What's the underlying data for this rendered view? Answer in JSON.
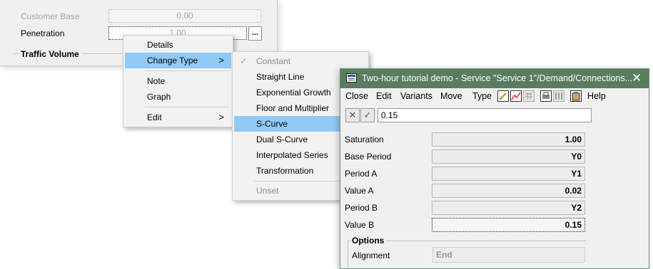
{
  "background_panel": {
    "customer_base_label": "Customer Base",
    "customer_base_value": "0.00",
    "penetration_label": "Penetration",
    "penetration_value": "1.00",
    "ellipsis_label": "...",
    "traffic_volume_title": "Traffic Volume"
  },
  "context_menu": {
    "items": [
      {
        "label": "Details"
      },
      {
        "label": "Change Type",
        "submenu": true
      },
      {
        "label": "Note"
      },
      {
        "label": "Graph"
      },
      {
        "label": "Edit",
        "submenu": true
      }
    ],
    "submenu_arrow": ">"
  },
  "submenu": {
    "items": [
      {
        "label": "Constant",
        "checked": true
      },
      {
        "label": "Straight Line"
      },
      {
        "label": "Exponential Growth"
      },
      {
        "label": "Floor and Multiplier"
      },
      {
        "label": "S-Curve"
      },
      {
        "label": "Dual S-Curve"
      },
      {
        "label": "Interpolated Series"
      },
      {
        "label": "Transformation"
      },
      {
        "label": "Unset",
        "disabled": true
      }
    ]
  },
  "dialog": {
    "title": "Two-hour tutorial demo  - Service \"Service 1\"/Demand/Connections...",
    "close_glyph": "✕",
    "menu": [
      "Close",
      "Edit",
      "Variants",
      "Move",
      "Type",
      "Help"
    ],
    "edit_cancel_glyph": "✕",
    "edit_accept_glyph": "✓",
    "edit_value": "0.15",
    "params": [
      {
        "label": "Saturation",
        "value": "1.00"
      },
      {
        "label": "Base Period",
        "value": "Y0"
      },
      {
        "label": "Period A",
        "value": "Y1"
      },
      {
        "label": "Value A",
        "value": "0.02"
      },
      {
        "label": "Period B",
        "value": "Y2"
      },
      {
        "label": "Value B",
        "value": "0.15"
      }
    ],
    "options_title": "Options",
    "alignment_label": "Alignment",
    "alignment_value": "End"
  },
  "icons": {
    "app": "app-window-icon",
    "toolbar": [
      "edit-note-icon",
      "line-chart-icon",
      "table-icon",
      "printer-icon",
      "columns-icon",
      "clipboard-icon"
    ]
  },
  "colors": {
    "titlebar": "#5a7c5f",
    "menu_highlight": "#91c9f7",
    "menu_background": "#f2f2f2"
  }
}
